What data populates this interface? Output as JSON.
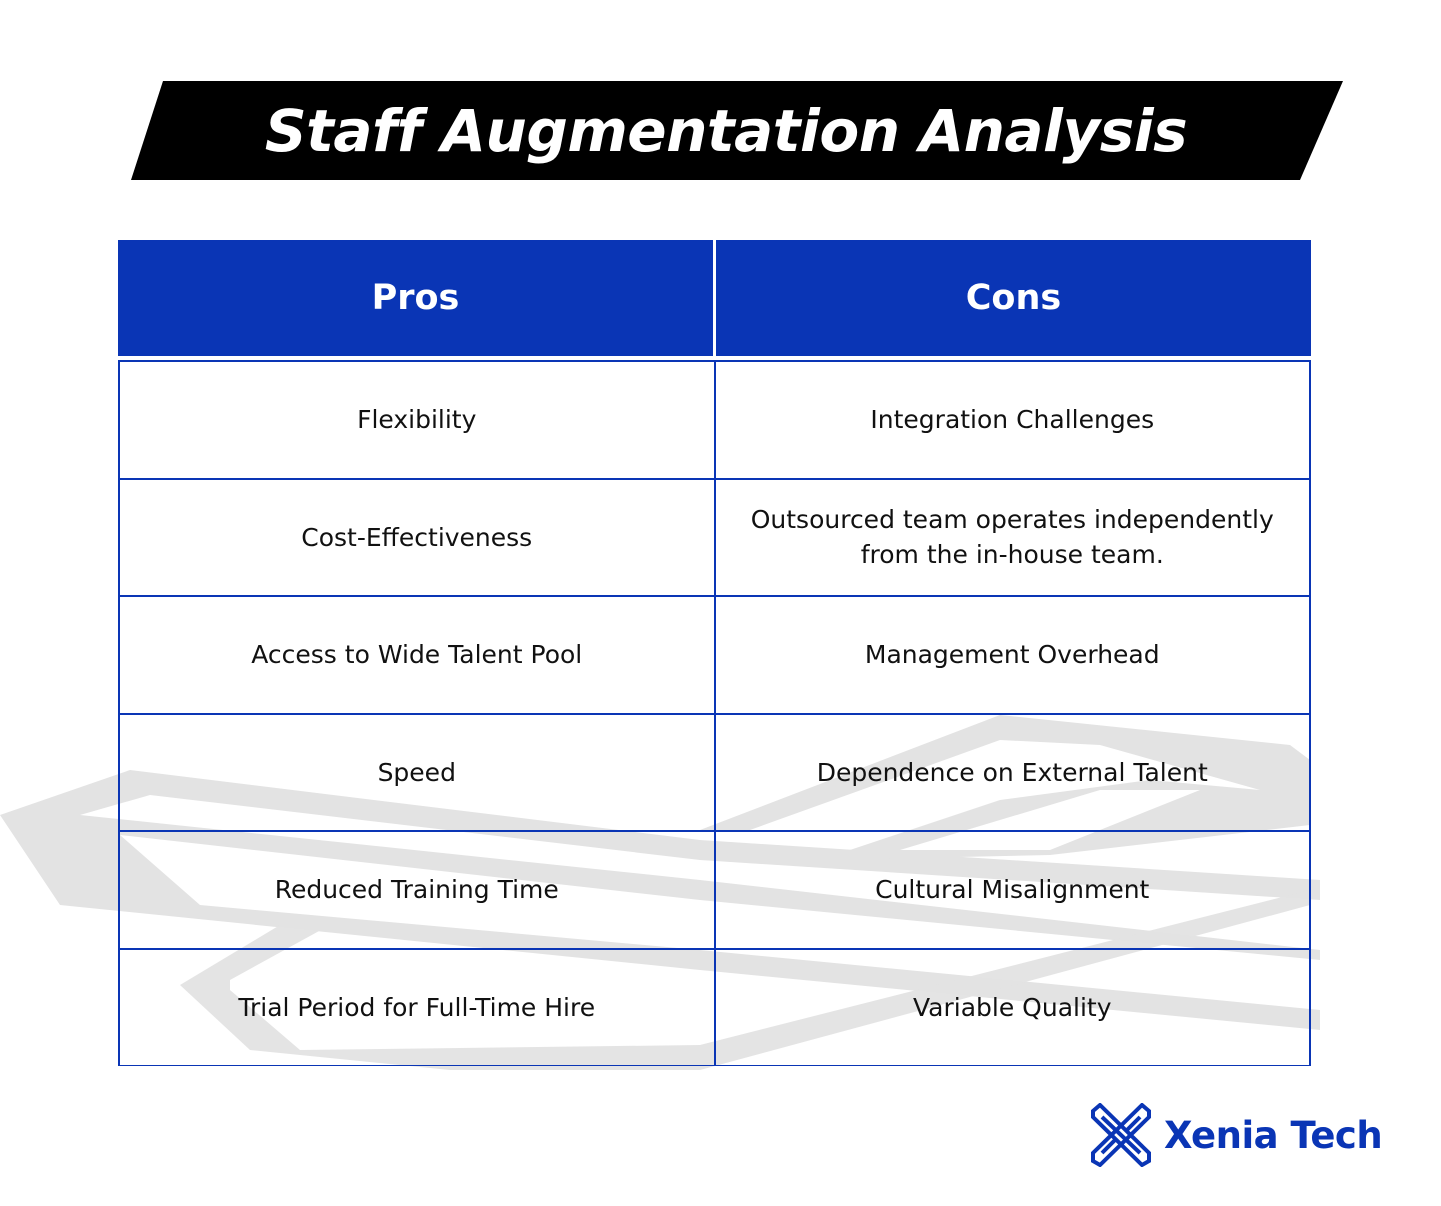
{
  "title": "Staff Augmentation Analysis",
  "colors": {
    "header_bg": "#0a35b5",
    "banner_bg": "#000000",
    "border": "#0a35b5",
    "watermark": "#e3e3e3",
    "brand": "#0a35b5"
  },
  "table": {
    "headers": [
      "Pros",
      "Cons"
    ],
    "rows": [
      [
        "Flexibility",
        "Integration Challenges"
      ],
      [
        "Cost-Effectiveness",
        "Outsourced team operates independently from the in-house team."
      ],
      [
        "Access to Wide Talent Pool",
        "Management Overhead"
      ],
      [
        "Speed",
        "Dependence on External Talent"
      ],
      [
        "Reduced Training Time",
        "Cultural Misalignment"
      ],
      [
        "Trial Period for Full-Time Hire",
        "Variable Quality"
      ]
    ]
  },
  "brand": {
    "icon": "x-logo-icon",
    "name": "Xenia Tech"
  }
}
